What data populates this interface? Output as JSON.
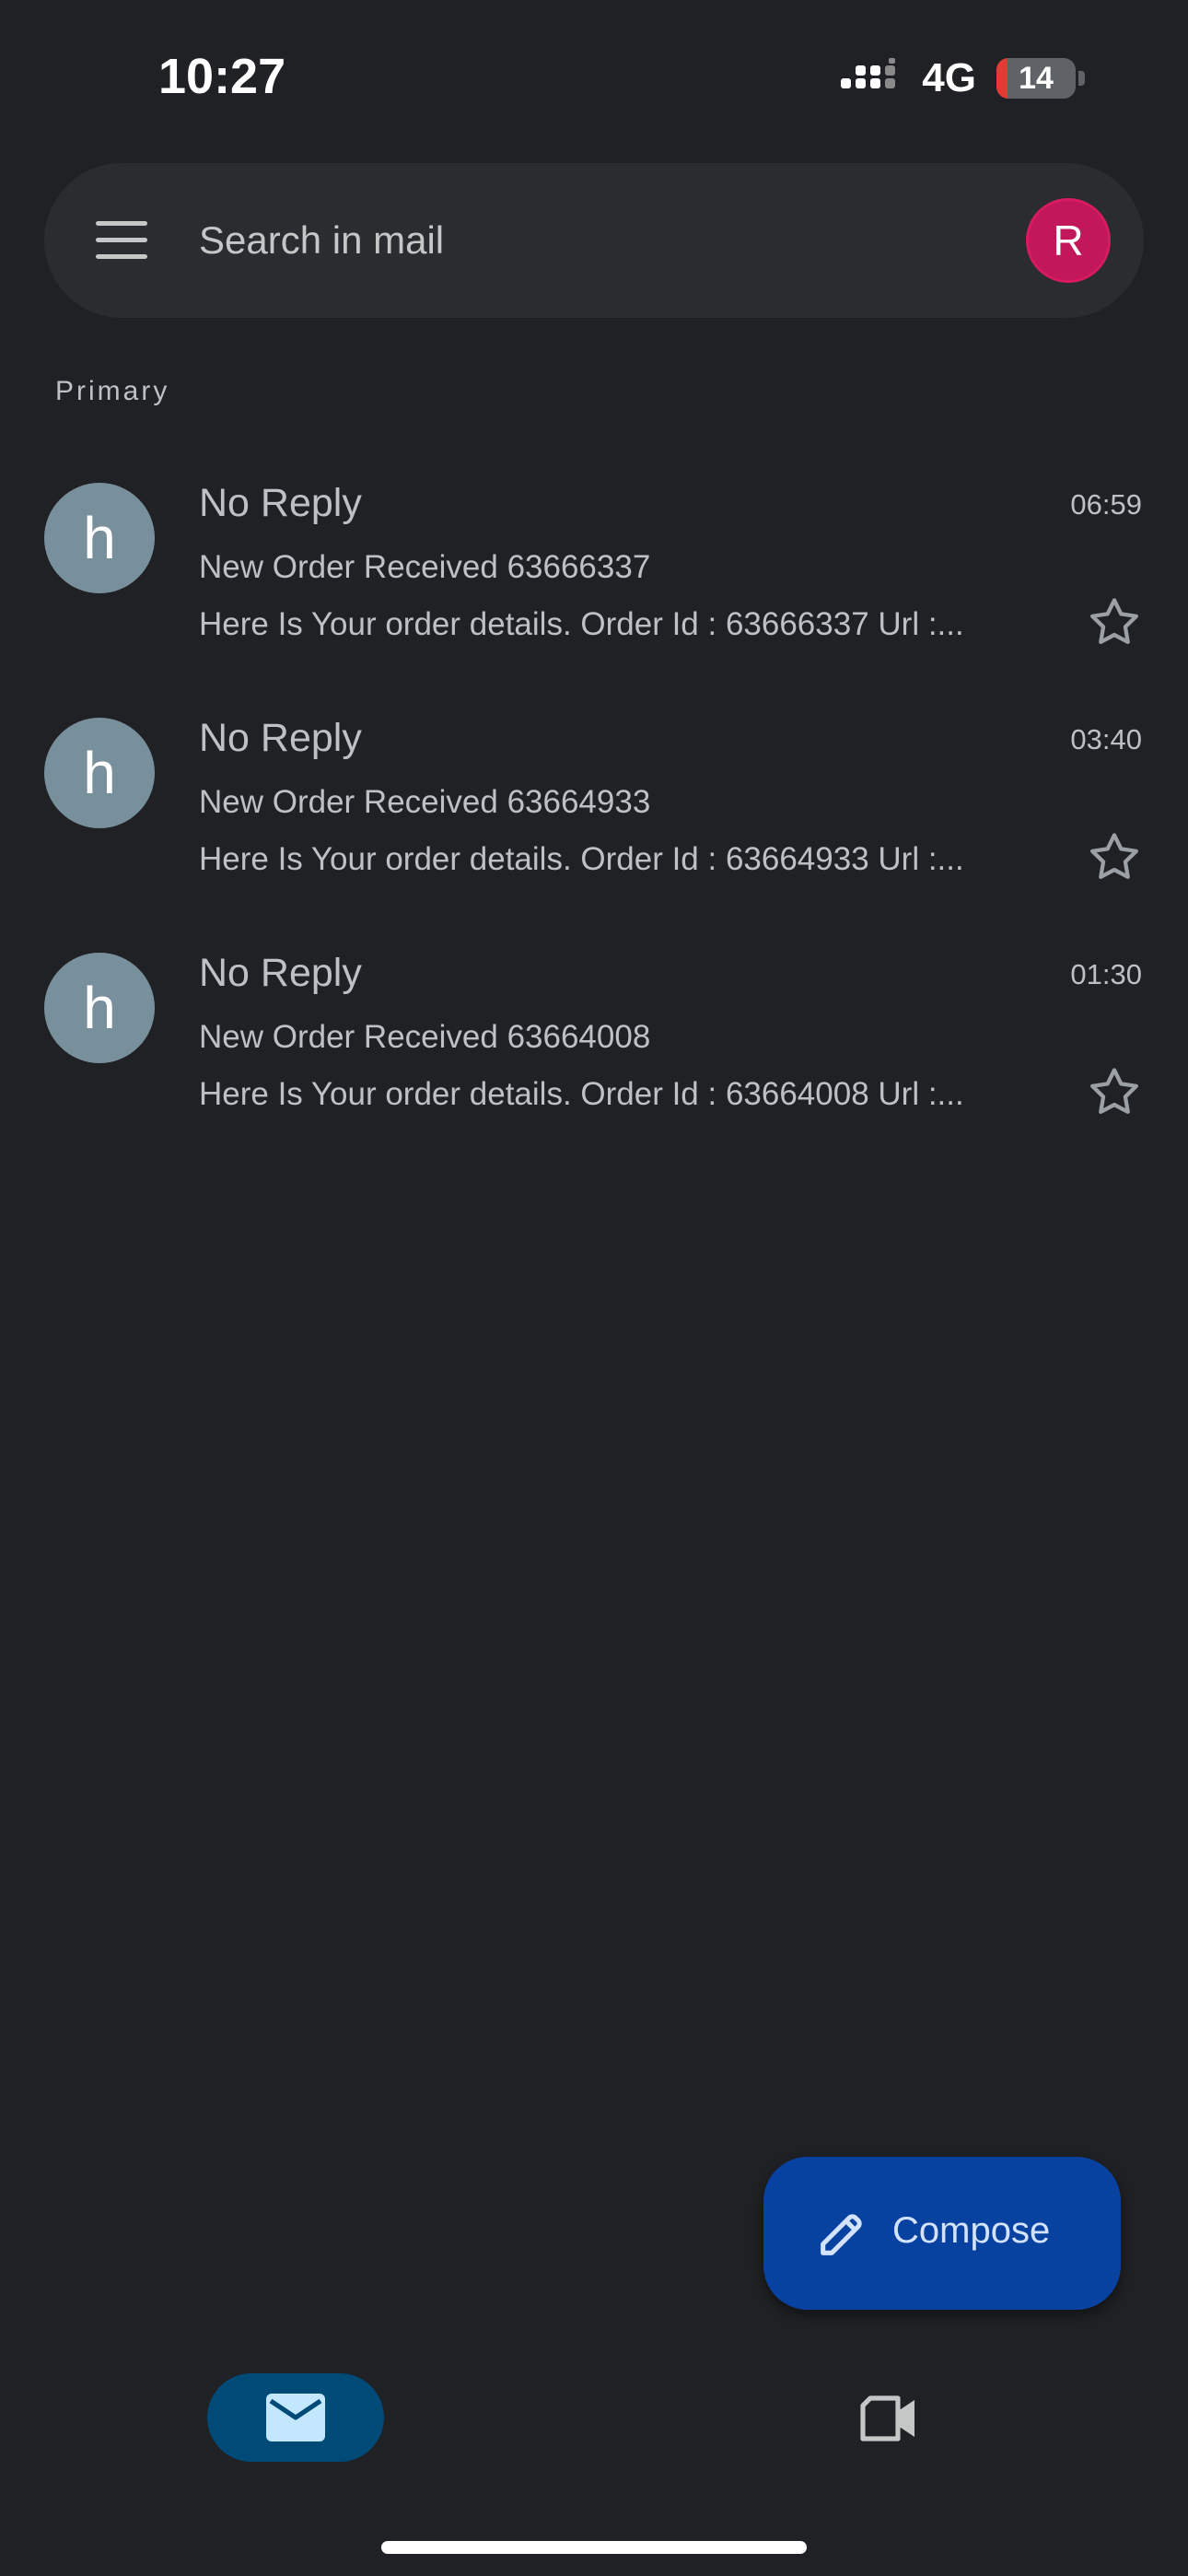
{
  "status_bar": {
    "time": "10:27",
    "network": "4G",
    "battery_level": "14",
    "battery_fraction": 0.14
  },
  "search": {
    "placeholder": "Search in mail",
    "account_initial": "R",
    "account_color": "#c2185b"
  },
  "section_label": "Primary",
  "emails": [
    {
      "avatar_letter": "h",
      "sender": "No Reply",
      "time": "06:59",
      "subject": "New Order Received 63666337",
      "snippet": "Here Is Your order details. Order Id : 63666337 Url :...",
      "starred": false
    },
    {
      "avatar_letter": "h",
      "sender": "No Reply",
      "time": "03:40",
      "subject": "New Order Received 63664933",
      "snippet": "Here Is Your order details. Order Id : 63664933 Url :...",
      "starred": false
    },
    {
      "avatar_letter": "h",
      "sender": "No Reply",
      "time": "01:30",
      "subject": "New Order Received 63664008",
      "snippet": "Here Is Your order details. Order Id : 63664008 Url :...",
      "starred": false
    }
  ],
  "compose": {
    "label": "Compose",
    "icon": "pencil-icon"
  },
  "bottom_nav": {
    "items": [
      {
        "icon": "mail-icon",
        "active": true
      },
      {
        "icon": "video-camera-icon",
        "active": false
      }
    ]
  },
  "colors": {
    "background": "#202124",
    "search_bar": "#2b2c2f",
    "sender_avatar": "#78909c",
    "compose_fab": "#0842a0",
    "nav_active": "#004a77",
    "battery_low": "#e53935"
  }
}
